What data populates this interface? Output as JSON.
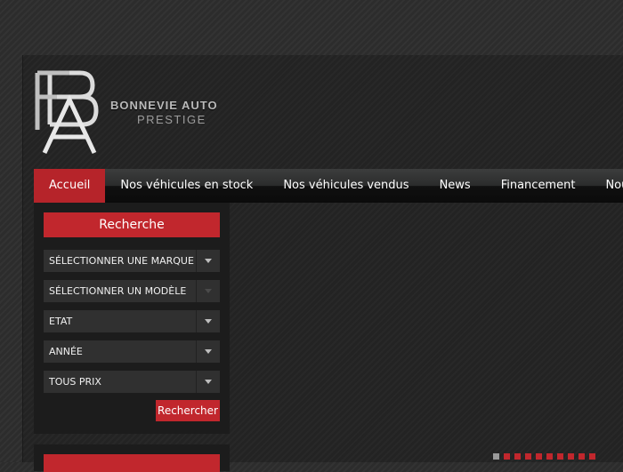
{
  "brand": {
    "name": "BONNEVIE AUTO",
    "tagline": "PRESTIGE"
  },
  "nav": {
    "items": [
      {
        "label": "Accueil",
        "active": true
      },
      {
        "label": "Nos véhicules en stock"
      },
      {
        "label": "Nos véhicules vendus"
      },
      {
        "label": "News"
      },
      {
        "label": "Financement"
      },
      {
        "label": "Nous co"
      }
    ]
  },
  "search": {
    "title": "Recherche",
    "selects": [
      {
        "label": "SÉLECTIONNER UNE MARQUE",
        "enabled": true
      },
      {
        "label": "SÉLECTIONNER UN MODÈLE",
        "enabled": false
      },
      {
        "label": "ETAT",
        "enabled": true
      },
      {
        "label": "ANNÉE",
        "enabled": true
      },
      {
        "label": "TOUS PRIX",
        "enabled": true
      }
    ],
    "submit_label": "Rechercher"
  },
  "slider": {
    "dot_count": 10,
    "active_index": 0
  },
  "colors": {
    "accent": "#c1272d",
    "nav_active": "#b6242a",
    "background": "#2c2c2c",
    "panel": "#1c1c1c"
  }
}
